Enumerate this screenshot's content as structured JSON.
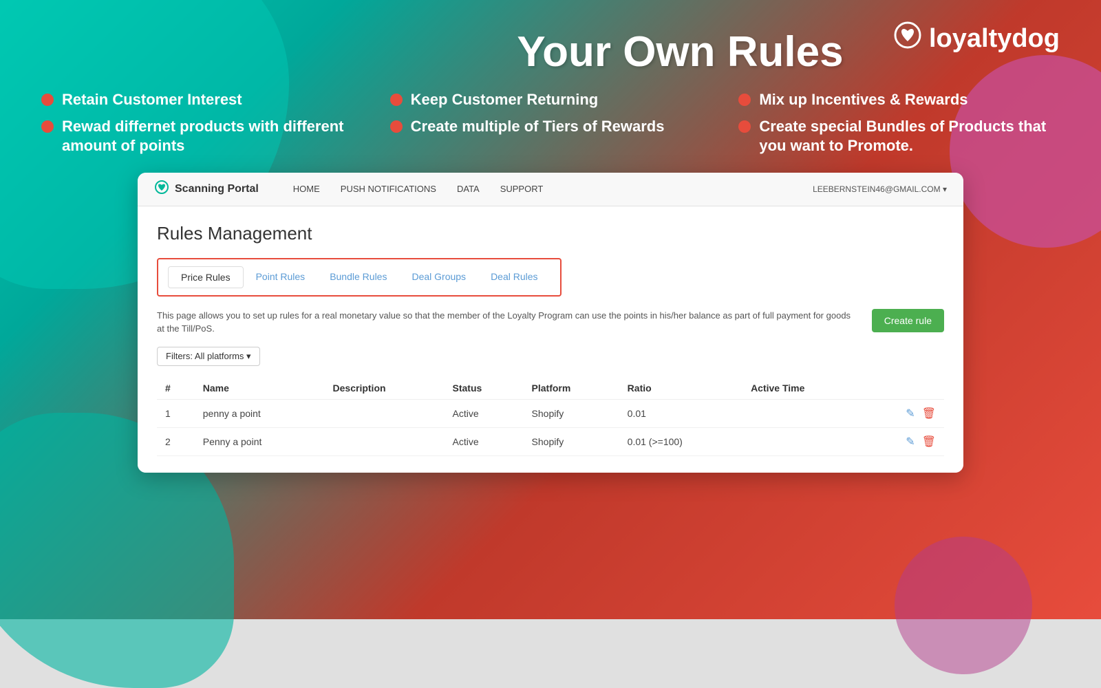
{
  "background": {
    "colors": {
      "teal": "#00c9b1",
      "red": "#e74c3c",
      "dark_red": "#c0392b"
    }
  },
  "header": {
    "title": "Your Own Rules",
    "logo_text": "loyaltydog",
    "logo_icon": "❤"
  },
  "bullets": [
    {
      "id": 1,
      "text": "Retain Customer Interest"
    },
    {
      "id": 2,
      "text": "Keep Customer Returning"
    },
    {
      "id": 3,
      "text": "Mix up Incentives & Rewards"
    },
    {
      "id": 4,
      "text": "Rewad differnet products with different amount of points"
    },
    {
      "id": 5,
      "text": "Create multiple of Tiers of Rewards"
    },
    {
      "id": 6,
      "text": "Create special Bundles of Products that you want to Promote."
    }
  ],
  "portal": {
    "nav": {
      "logo_icon": "⊙",
      "logo_text": "Scanning Portal",
      "links": [
        {
          "label": "HOME"
        },
        {
          "label": "PUSH NOTIFICATIONS"
        },
        {
          "label": "DATA"
        },
        {
          "label": "SUPPORT"
        }
      ],
      "user": "LEEBERNSTEIN46@GMAIL.COM ▾"
    },
    "page_title": "Rules Management",
    "tabs": [
      {
        "label": "Price Rules",
        "active": true
      },
      {
        "label": "Point Rules",
        "active": false
      },
      {
        "label": "Bundle Rules",
        "active": false
      },
      {
        "label": "Deal Groups",
        "active": false
      },
      {
        "label": "Deal Rules",
        "active": false
      }
    ],
    "description": "This page allows you to set up rules for a real monetary value so that the member of the Loyalty Program can use the points in his/her balance as part of full payment for goods at the Till/PoS.",
    "create_button": "Create rule",
    "filter_label": "Filters: All platforms ▾",
    "table": {
      "columns": [
        "#",
        "Name",
        "Description",
        "Status",
        "Platform",
        "Ratio",
        "Active Time",
        ""
      ],
      "rows": [
        {
          "num": "1",
          "name": "penny a point",
          "description": "",
          "status": "Active",
          "platform": "Shopify",
          "ratio": "0.01",
          "active_time": ""
        },
        {
          "num": "2",
          "name": "Penny a point",
          "description": "",
          "status": "Active",
          "platform": "Shopify",
          "ratio": "0.01 (>=100)",
          "active_time": ""
        }
      ]
    }
  }
}
